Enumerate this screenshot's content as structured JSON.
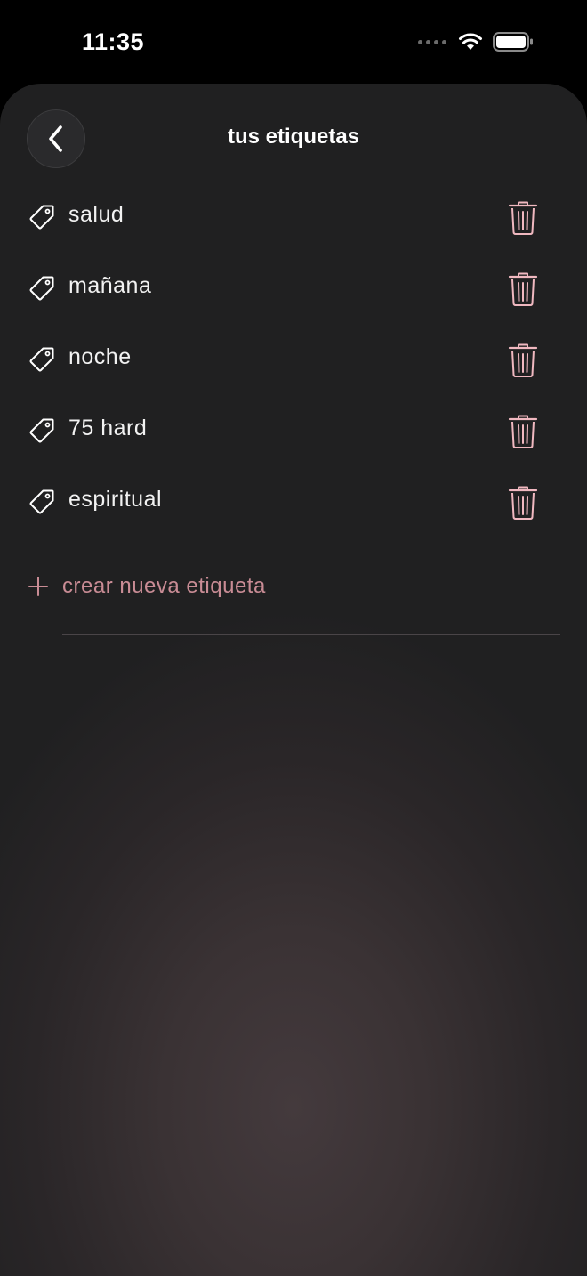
{
  "status_bar": {
    "time": "11:35"
  },
  "header": {
    "title": "tus etiquetas",
    "back_icon": "chevron-left-icon"
  },
  "tags": [
    {
      "label": "salud"
    },
    {
      "label": "mañana"
    },
    {
      "label": "noche"
    },
    {
      "label": "75 hard"
    },
    {
      "label": "espiritual"
    }
  ],
  "create": {
    "label": "crear nueva etiqueta",
    "icon": "plus-icon"
  },
  "colors": {
    "accent": "#c98c95",
    "trash": "#f0b8c0",
    "background": "#202021",
    "text": "#f2f2f2"
  }
}
